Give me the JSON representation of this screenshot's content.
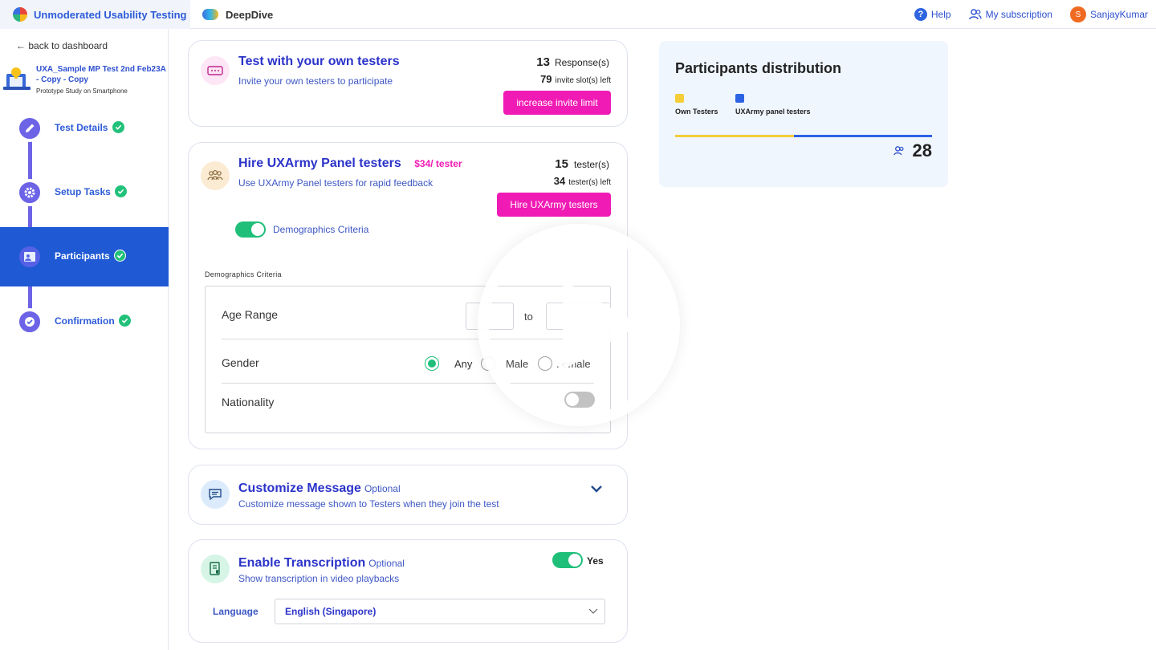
{
  "topbar": {
    "tab_active": "Unmoderated Usability Testing",
    "tab_second": "DeepDive",
    "help": "Help",
    "subscription": "My subscription",
    "user_initial": "S",
    "user_name": "SanjayKumar"
  },
  "sidebar": {
    "back": "back to dashboard",
    "project_title": "UXA_Sample MP Test 2nd Feb23A - Copy - Copy",
    "project_sub": "Prototype Study on Smartphone",
    "steps": [
      {
        "label": "Test Details"
      },
      {
        "label": "Setup Tasks"
      },
      {
        "label": "Participants"
      },
      {
        "label": "Confirmation"
      }
    ]
  },
  "own_testers": {
    "title": "Test with your own testers",
    "subtitle": "Invite your own testers to participate",
    "responses_num": "13",
    "responses_label": "Response(s)",
    "slots_num": "79",
    "slots_label": "invite slot(s) left",
    "button": "increase invite limit"
  },
  "panel_testers": {
    "title": "Hire UXArmy Panel testers",
    "price": "$34/ tester",
    "subtitle": "Use UXArmy Panel testers for rapid feedback",
    "testers_num": "15",
    "testers_label": "tester(s)",
    "left_num": "34",
    "left_label": "tester(s) left",
    "button": "Hire UXArmy testers",
    "demographics_toggle": "Demographics Criteria",
    "demographics_heading": "Demographics Criteria",
    "age_label": "Age Range",
    "age_to": "to",
    "gender_label": "Gender",
    "gender_options": [
      "Any",
      "Male",
      "Female"
    ],
    "gender_female_visible": ". emale",
    "nationality_label": "Nationality"
  },
  "customize": {
    "title": "Customize Message",
    "optional": "Optional",
    "subtitle": "Customize message shown to Testers when they join the test"
  },
  "transcription": {
    "title": "Enable Transcription",
    "optional": "Optional",
    "subtitle": "Show transcription in video playbacks",
    "toggle_label": "Yes",
    "language_label": "Language",
    "language_value": "English (Singapore)"
  },
  "distribution": {
    "title": "Participants distribution",
    "legend_own": "Own Testers",
    "legend_ux": "UXArmy panel testers",
    "total": "28",
    "colors": {
      "own": "#f5cd37",
      "ux": "#2c63e5"
    }
  }
}
